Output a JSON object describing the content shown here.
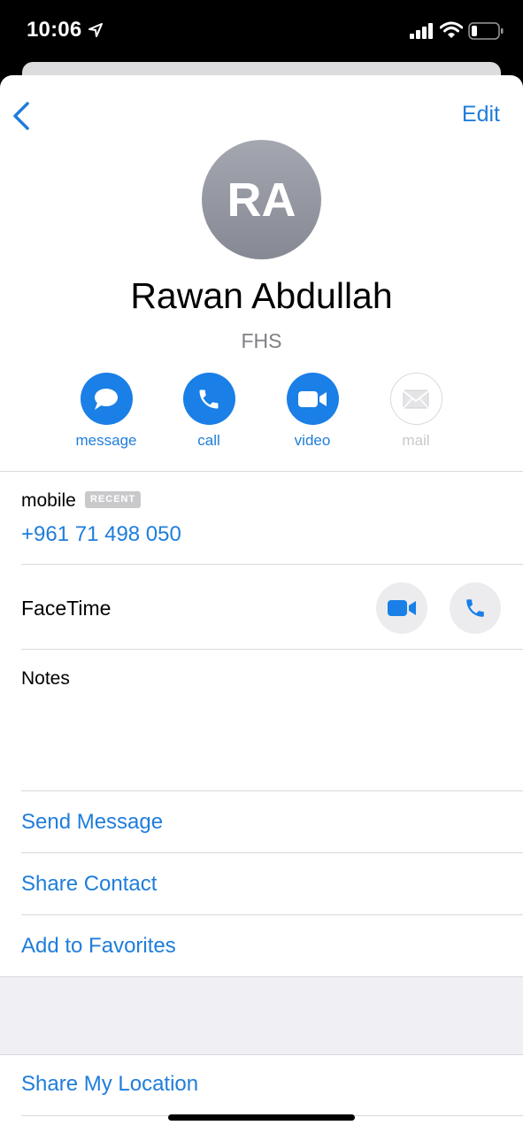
{
  "status": {
    "time": "10:06"
  },
  "nav": {
    "edit_label": "Edit"
  },
  "contact": {
    "initials": "RA",
    "name": "Rawan Abdullah",
    "company": "FHS"
  },
  "actions": [
    {
      "label": "message",
      "icon": "message-bubble-icon",
      "enabled": true
    },
    {
      "label": "call",
      "icon": "phone-icon",
      "enabled": true
    },
    {
      "label": "video",
      "icon": "video-camera-icon",
      "enabled": true
    },
    {
      "label": "mail",
      "icon": "envelope-icon",
      "enabled": false
    }
  ],
  "phone": {
    "label": "mobile",
    "badge": "RECENT",
    "number": "+961 71 498 050"
  },
  "facetime": {
    "label": "FaceTime"
  },
  "notes": {
    "label": "Notes",
    "value": ""
  },
  "links": {
    "send_message": "Send Message",
    "share_contact": "Share Contact",
    "add_favorites": "Add to Favorites",
    "share_location": "Share My Location"
  },
  "colors": {
    "accent": "#1f7ddb",
    "action_fill": "#1a7fe6",
    "disabled": "#c9c9cc"
  }
}
